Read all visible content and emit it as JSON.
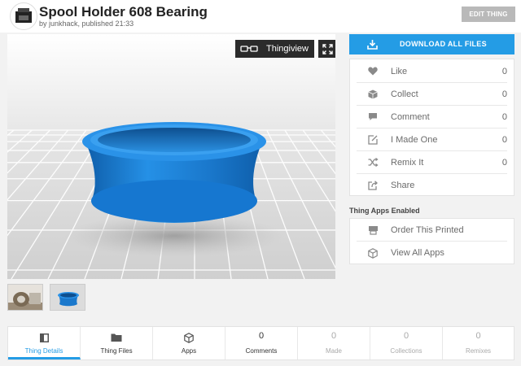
{
  "header": {
    "title": "Spool Holder 608 Bearing",
    "byline": "by junkhack, published 21:33",
    "edit_label": "EDIT THING",
    "avatar_icon": "printer-icon"
  },
  "viewer": {
    "thingiview_label": "Thingiview",
    "thingiview_icon": "glasses-icon",
    "fullscreen_icon": "expand-icon",
    "model_color": "#1f85d8",
    "floor_color": "#d4d4d4"
  },
  "thumbnails": [
    {
      "name": "photo-thumbnail"
    },
    {
      "name": "render-thumbnail"
    }
  ],
  "download": {
    "label": "DOWNLOAD ALL FILES",
    "icon": "download-icon",
    "color": "#249ce5"
  },
  "actions": [
    {
      "label": "Like",
      "count": "0",
      "icon": "heart-icon"
    },
    {
      "label": "Collect",
      "count": "0",
      "icon": "cube-icon"
    },
    {
      "label": "Comment",
      "count": "0",
      "icon": "speech-bubble-icon"
    },
    {
      "label": "I Made One",
      "count": "0",
      "icon": "edit-icon"
    },
    {
      "label": "Remix It",
      "count": "0",
      "icon": "shuffle-icon"
    },
    {
      "label": "Share",
      "icon": "share-icon"
    }
  ],
  "apps": {
    "heading": "Thing Apps Enabled",
    "items": [
      {
        "label": "Order This Printed",
        "icon": "printer-icon"
      },
      {
        "label": "View All Apps",
        "icon": "cube-outline-icon"
      }
    ]
  },
  "tabs": [
    {
      "label": "Thing Details",
      "icon": "book-icon"
    },
    {
      "label": "Thing Files",
      "icon": "folder-icon"
    },
    {
      "label": "Apps",
      "icon": "cube-outline-icon"
    },
    {
      "label": "Comments",
      "count": "0"
    },
    {
      "label": "Made",
      "count": "0"
    },
    {
      "label": "Collections",
      "count": "0"
    },
    {
      "label": "Remixes",
      "count": "0"
    }
  ]
}
